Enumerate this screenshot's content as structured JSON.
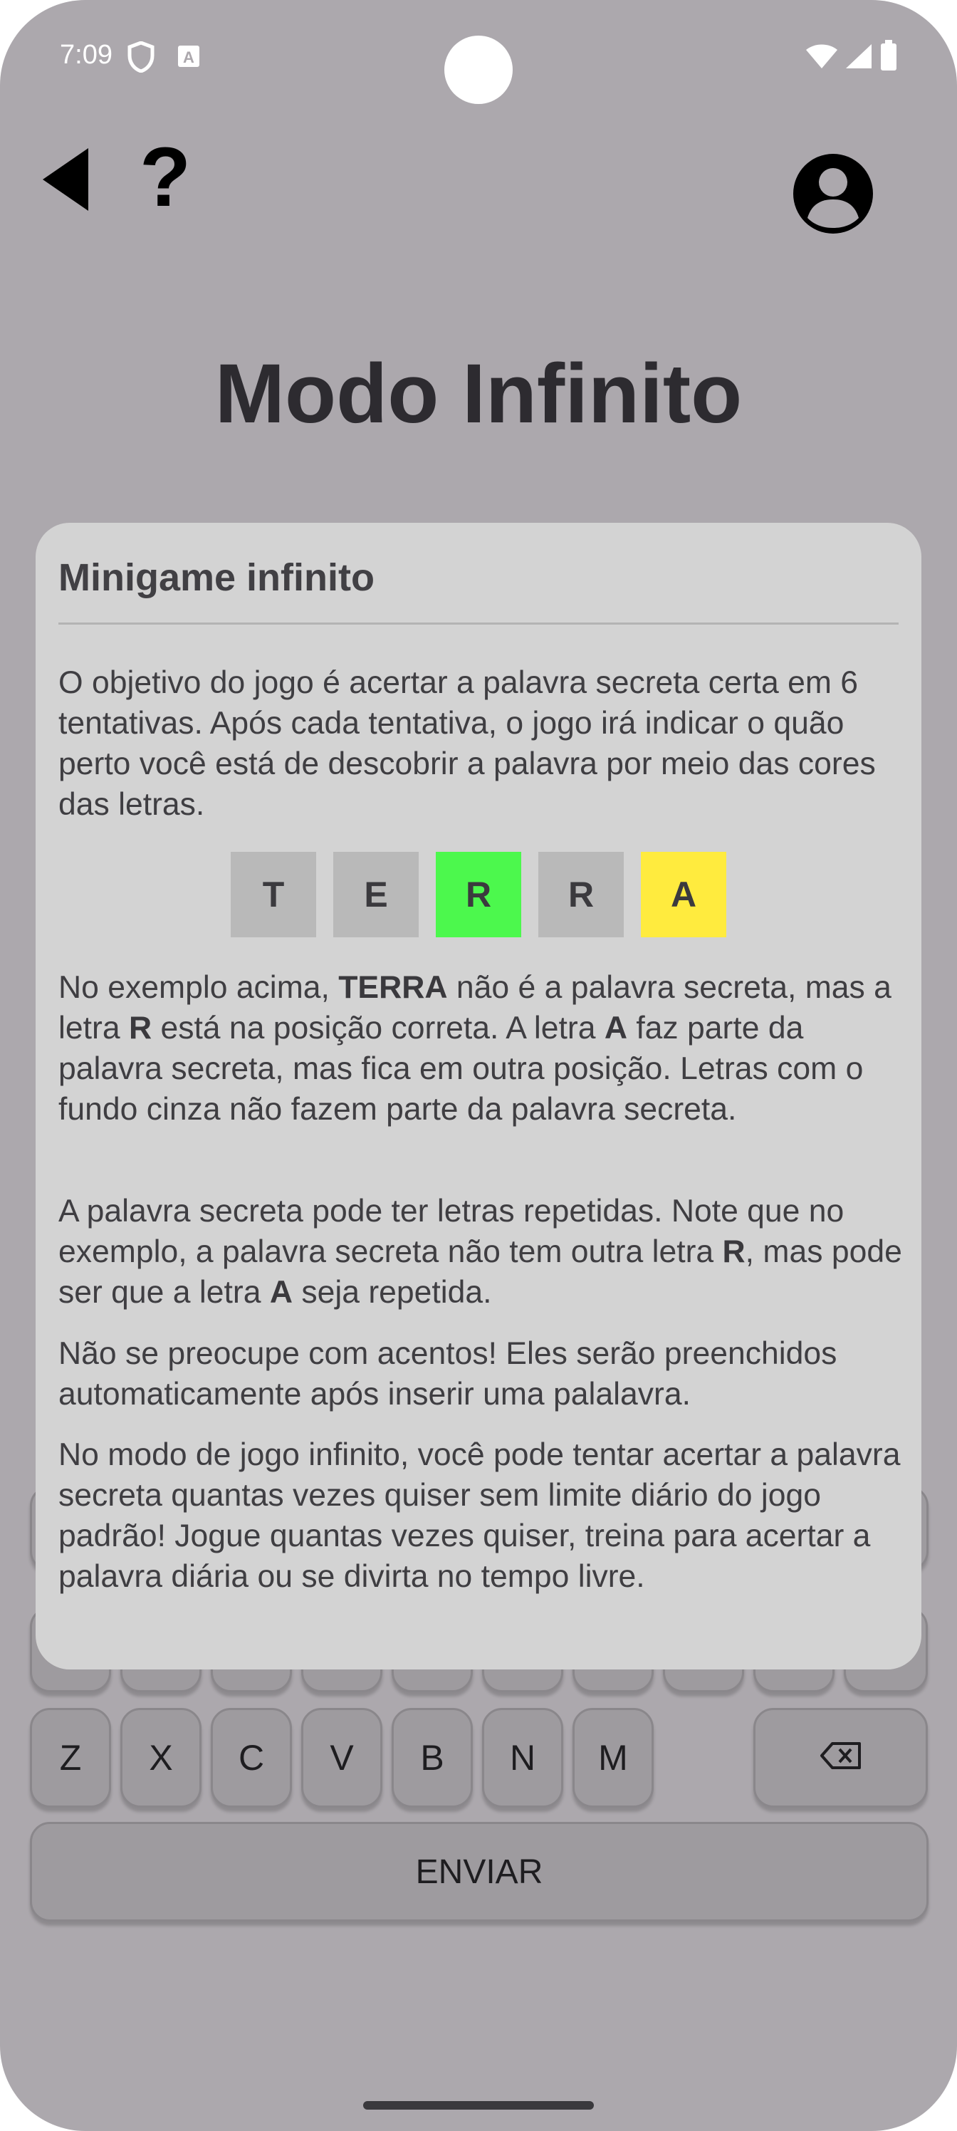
{
  "status_bar": {
    "time": "7:09"
  },
  "nav": {
    "help_label": "?"
  },
  "title": "Modo Infinito",
  "dialog": {
    "title": "Minigame infinito",
    "intro": "O objetivo do jogo é acertar a palavra secreta certa em 6 tentativas. Após cada tentativa, o jogo irá indicar o quão perto você está de descobrir a palavra por meio das cores das letras.",
    "example_tiles": [
      {
        "letter": "T",
        "color": "#b9b9b9"
      },
      {
        "letter": "E",
        "color": "#b9b9b9"
      },
      {
        "letter": "R",
        "color": "#4cf84d"
      },
      {
        "letter": "R",
        "color": "#b9b9b9"
      },
      {
        "letter": "A",
        "color": "#ffeb3e"
      }
    ],
    "explanation": {
      "t1": "No exemplo acima, ",
      "b1": "TERRA",
      "t2": " não é a palavra secreta, mas a letra ",
      "b2": "R",
      "t3": " está na posição correta. A letra ",
      "b3": "A",
      "t4": " faz parte da palavra secreta, mas fica em outra posição. Letras com o fundo cinza não fazem parte da palavra secreta."
    },
    "repeated": {
      "t1": "A palavra secreta pode ter letras repetidas. Note que no exemplo, a palavra secreta não tem outra letra ",
      "b1": "R",
      "t2": ", mas pode ser que a letra ",
      "b2": "A",
      "t3": " seja repetida."
    },
    "accents": "Não se preocupe com acentos! Eles serão preenchidos automaticamente após inserir uma palalavra.",
    "infinite": "No modo de jogo infinito, você pode tentar acertar a palavra secreta quantas vezes quiser sem limite diário do jogo padrão! Jogue quantas vezes quiser, treina para acertar a palavra diária ou se divirta no tempo livre."
  },
  "keyboard": {
    "row3": [
      "Z",
      "X",
      "C",
      "V",
      "B",
      "N",
      "M"
    ],
    "backspace_icon": "backspace-icon",
    "submit_label": "ENVIAR"
  },
  "colors": {
    "scrim_background": "#aca8ad",
    "dialog_background": "#d3d3d3"
  }
}
